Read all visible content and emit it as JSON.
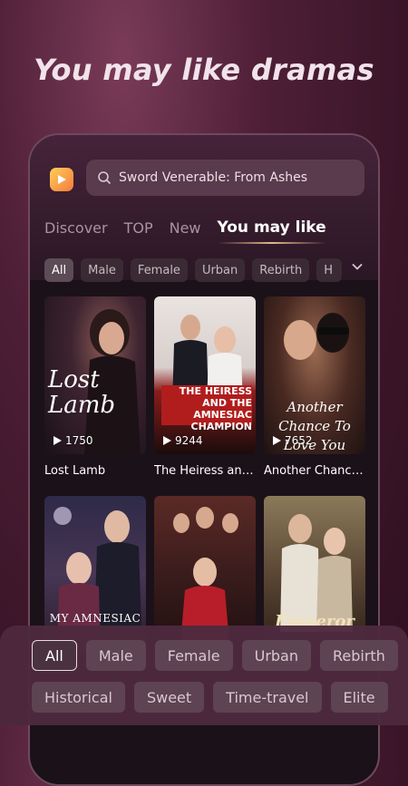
{
  "headline": "You may like dramas",
  "search": {
    "placeholder": "Sword Venerable: From Ashes"
  },
  "tabs": [
    {
      "label": "Discover"
    },
    {
      "label": "TOP"
    },
    {
      "label": "New"
    },
    {
      "label": "You may like"
    }
  ],
  "chips": [
    "All",
    "Male",
    "Female",
    "Urban",
    "Rebirth",
    "H"
  ],
  "dramas": [
    {
      "title": "Lost Lamb",
      "views": "1750",
      "poster_text": "Lost Lamb"
    },
    {
      "title": "The Heiress and the Amnesiac Champion",
      "views": "9244",
      "poster_text": "THE HEIRESS AND THE AMNESIAC CHAMPION"
    },
    {
      "title": "Another Chance to Love You",
      "views": "7652",
      "poster_text": "Another Chance To Love You"
    },
    {
      "title": "",
      "views": "",
      "poster_text": "MY AMNESIAC"
    },
    {
      "title": "",
      "views": "",
      "poster_text": ""
    },
    {
      "title": "",
      "views": "",
      "poster_text": "Emperor"
    }
  ],
  "sheet_filters": {
    "row1": [
      "All",
      "Male",
      "Female",
      "Urban",
      "Rebirth"
    ],
    "row2": [
      "Historical",
      "Sweet",
      "Time-travel",
      "Elite"
    ]
  },
  "colors": {
    "accent": "#e7b98a",
    "background": "#3a1528"
  }
}
